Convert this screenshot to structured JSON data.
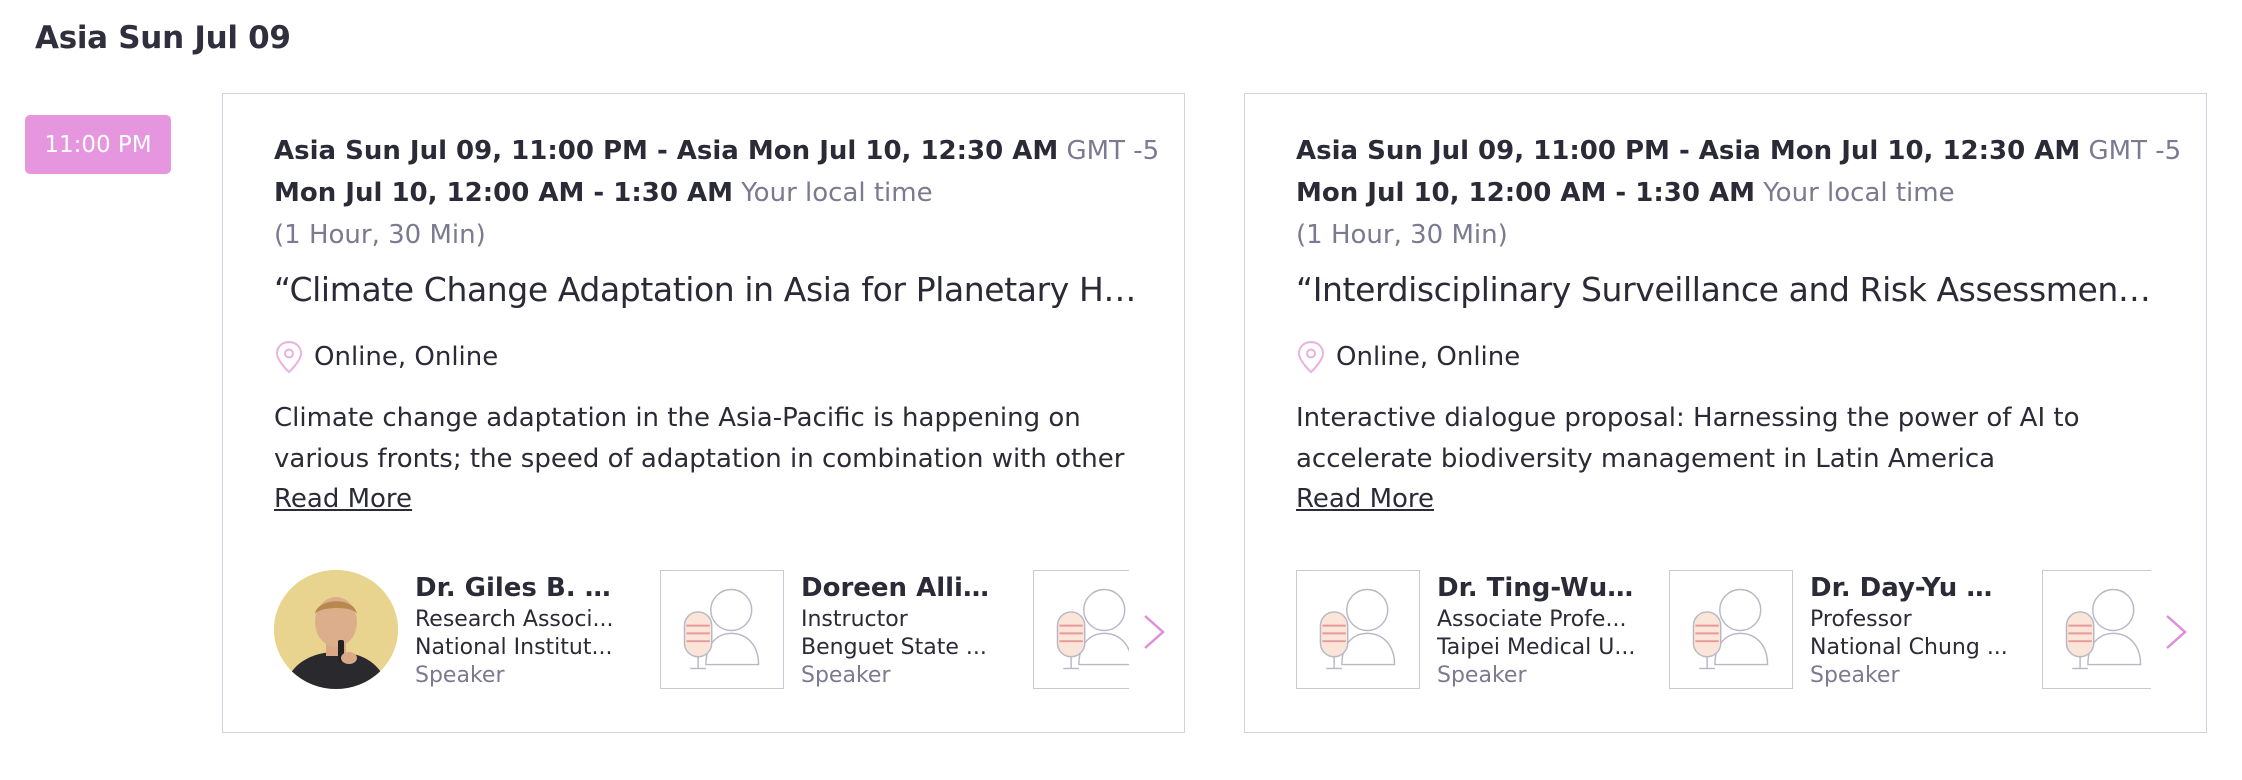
{
  "day_heading": "Asia Sun Jul 09",
  "time_badge": "11:00 PM",
  "accent_color": "#e696de",
  "sessions": [
    {
      "event_time": "Asia Sun Jul 09, 11:00 PM - Asia Mon Jul 10, 12:30 AM",
      "tz_label": "GMT -5",
      "local_time": "Mon Jul 10, 12:00 AM - 1:30 AM",
      "local_label": "Your local time",
      "duration": "(1 Hour, 30 Min)",
      "title": "“Climate Change Adaptation in Asia for Planetary Health”",
      "location": "Online, Online",
      "description": "Climate change adaptation in the Asia-Pacific is happening on various fronts; the speed of adaptation in combination with other issues of",
      "read_more": "Read More",
      "speakers": [
        {
          "name": "Dr. Giles B. Si...",
          "title": "Research Associ...",
          "org": "National Institut...",
          "role": "Speaker",
          "image": "photo"
        },
        {
          "name": "Doreen Allisaw",
          "title": "Instructor",
          "org": "Benguet State ...",
          "role": "Speaker",
          "image": "placeholder"
        },
        {
          "name": "",
          "title": "",
          "org": "",
          "role": "",
          "image": "placeholder"
        }
      ]
    },
    {
      "event_time": "Asia Sun Jul 09, 11:00 PM - Asia Mon Jul 10, 12:30 AM",
      "tz_label": "GMT -5",
      "local_time": "Mon Jul 10, 12:00 AM - 1:30 AM",
      "local_label": "Your local time",
      "duration": "(1 Hour, 30 Min)",
      "title": "“Interdisciplinary Surveillance and Risk Assessment Platfor...",
      "location": "Online, Online",
      "description": "Interactive dialogue proposal: Harnessing the power of AI to accelerate biodiversity management in Latin America  Justification: Global",
      "read_more": "Read More",
      "speakers": [
        {
          "name": "Dr. Ting-Wu ...",
          "title": "Associate Profe...",
          "org": "Taipei Medical U...",
          "role": "Speaker",
          "image": "placeholder"
        },
        {
          "name": "Dr. Day-Yu Ch...",
          "title": "Professor",
          "org": "National Chung ...",
          "role": "Speaker",
          "image": "placeholder"
        },
        {
          "name": "",
          "title": "",
          "org": "",
          "role": "",
          "image": "placeholder"
        }
      ]
    }
  ]
}
